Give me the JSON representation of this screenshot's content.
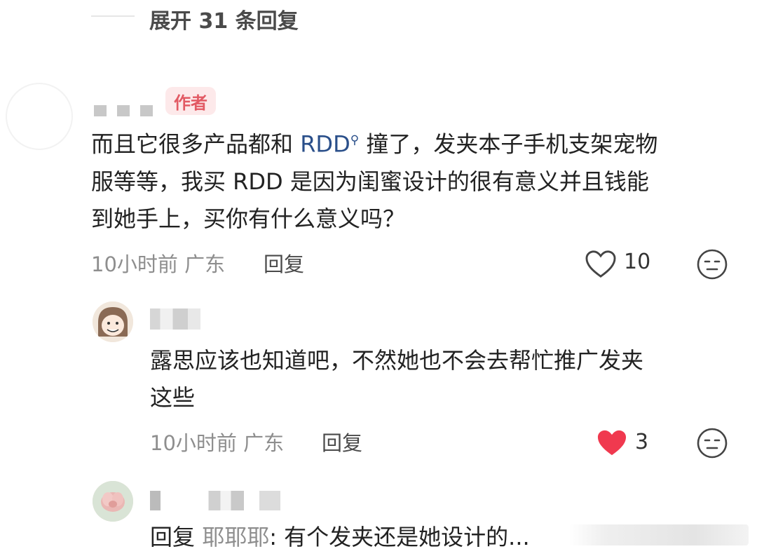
{
  "thread": {
    "expand_label": "展开 31 条回复"
  },
  "comment_main": {
    "author_badge": "作者",
    "text_part1": "而且它很多产品都和 ",
    "mention": "RDD",
    "text_part2": " 撞了，发夹本子手机支架宠物",
    "text_line2": "服等等，我买 RDD 是因为闺蜜设计的很有意义并且钱能",
    "text_line3": "到她手上，买你有什么意义吗？",
    "time": "10小时前",
    "location": "广东",
    "reply_label": "回复",
    "likes": "10",
    "liked": false
  },
  "reply1": {
    "text_line1": "露思应该也知道吧，不然她也不会去帮忙推广发夹",
    "text_line2": "这些",
    "time": "10小时前",
    "location": "广东",
    "reply_label": "回复",
    "likes": "3",
    "liked": true,
    "like_color": "#f0394f"
  },
  "reply2": {
    "prefix": "回复 ",
    "reply_to": "耶耶耶",
    "text": ": 有个发夹还是她设计的..."
  },
  "icons": {
    "like": "heart-outline-icon",
    "liked": "heart-filled-icon",
    "dislike": "neutral-face-icon"
  }
}
